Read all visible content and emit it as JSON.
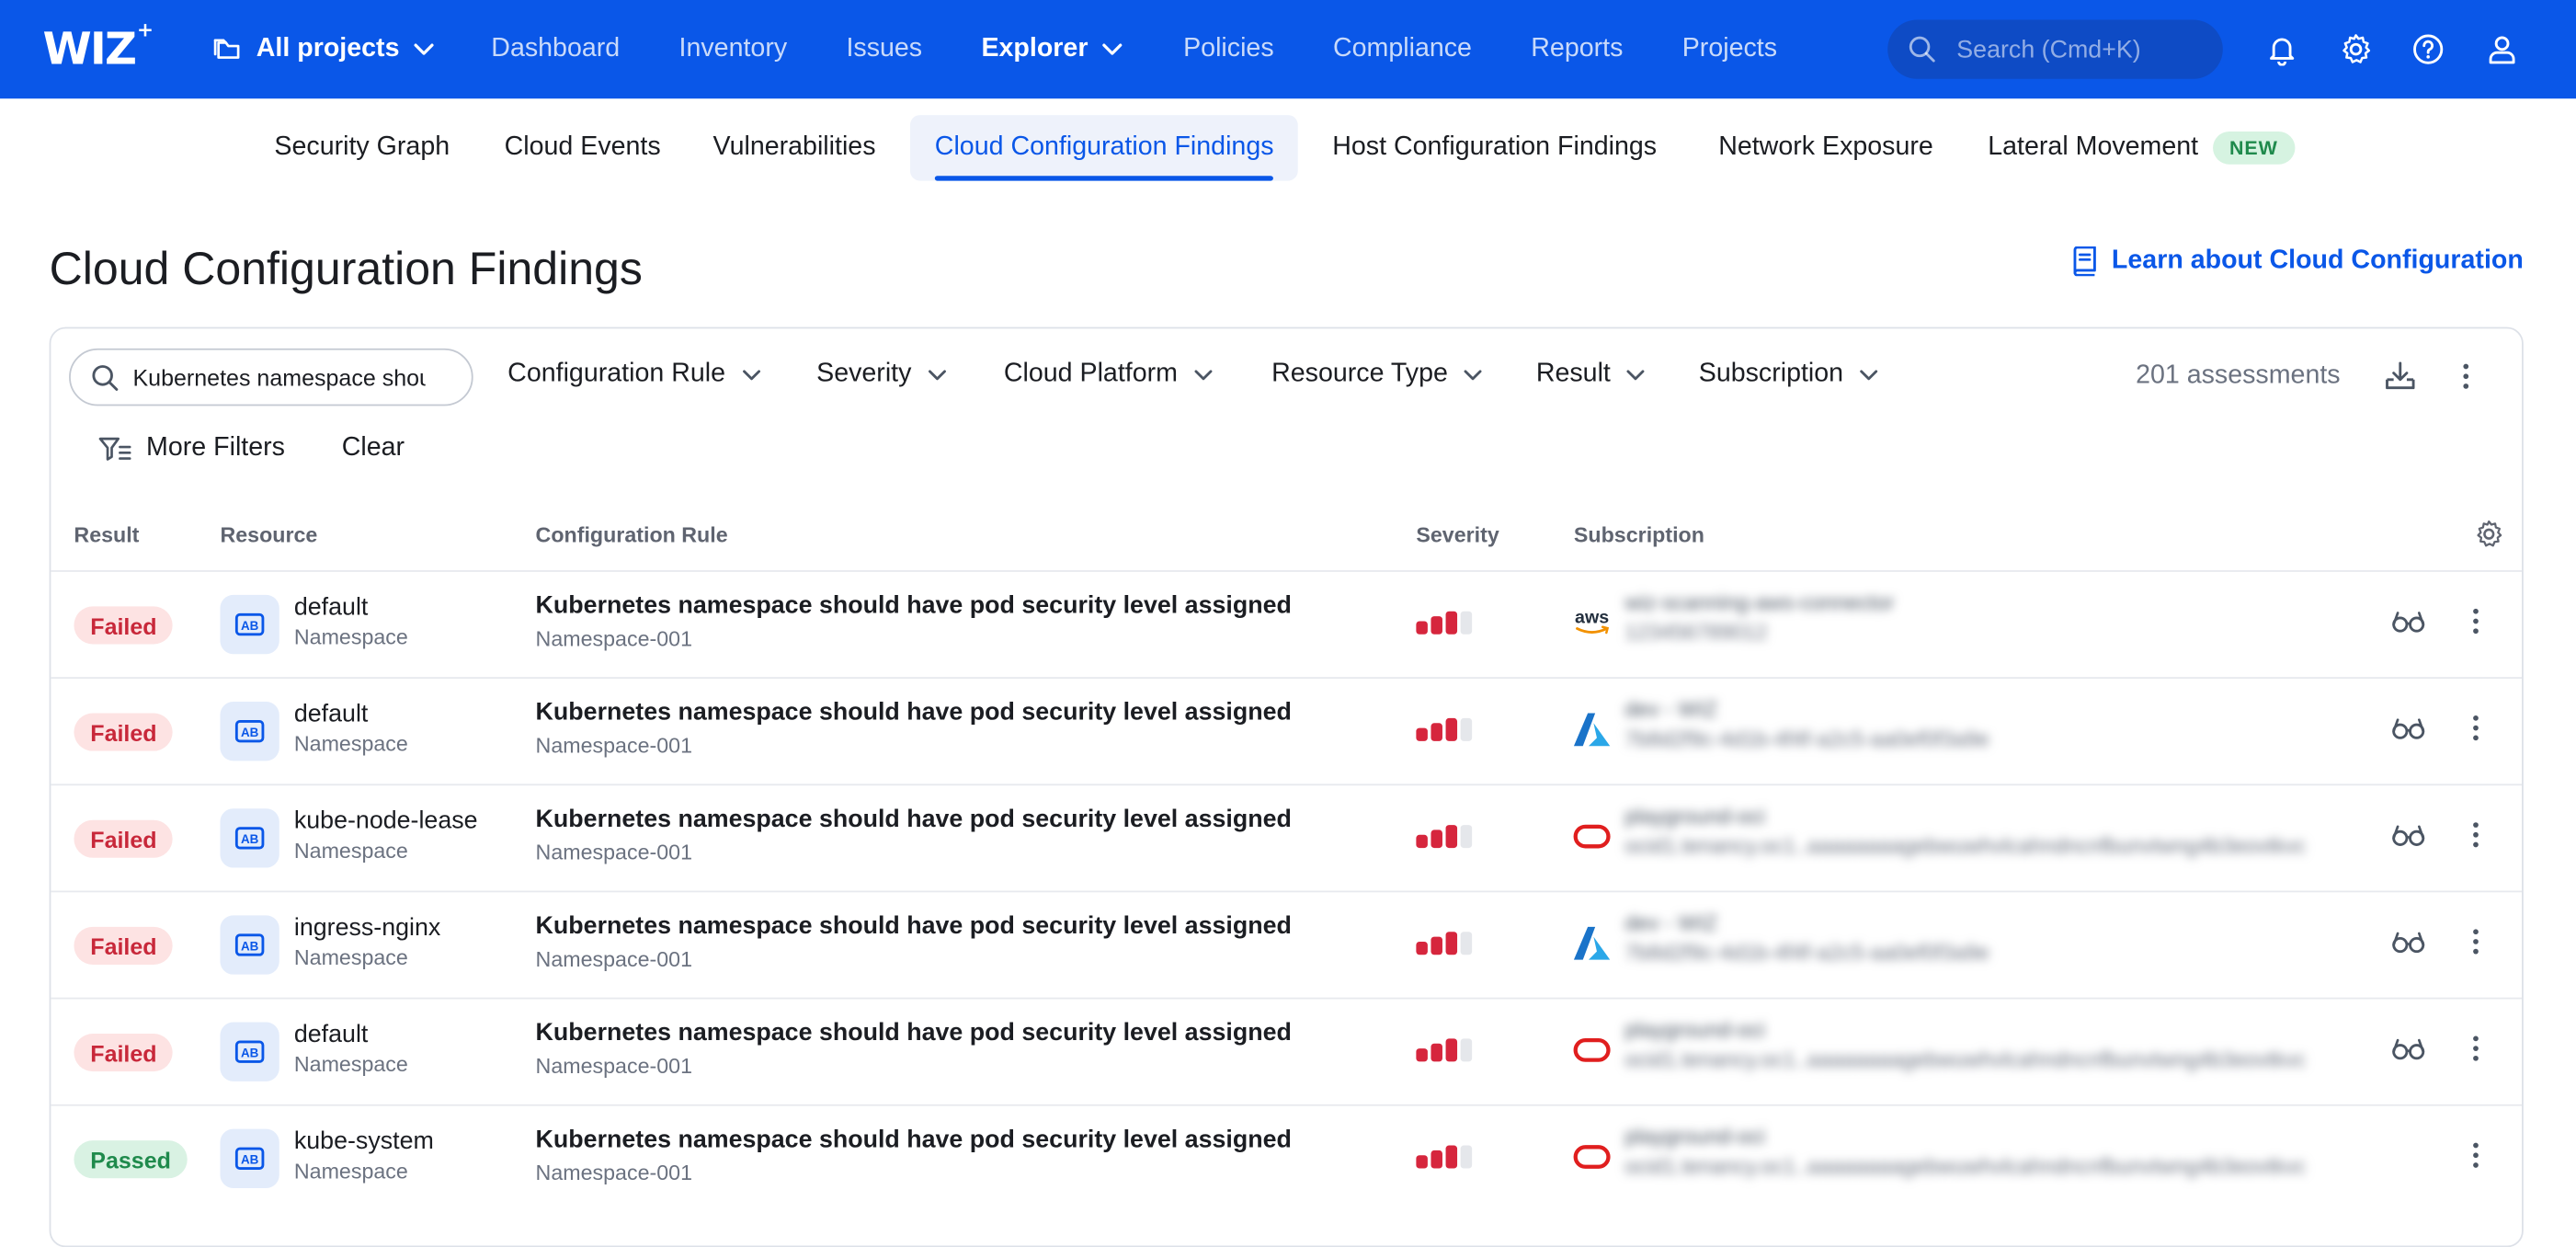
{
  "brand": {
    "name": "WIZ",
    "spark": "+"
  },
  "topnav": {
    "project_label": "All projects",
    "items": [
      {
        "label": "Dashboard"
      },
      {
        "label": "Inventory"
      },
      {
        "label": "Issues"
      },
      {
        "label": "Explorer",
        "active": true
      },
      {
        "label": "Policies"
      },
      {
        "label": "Compliance"
      },
      {
        "label": "Reports"
      },
      {
        "label": "Projects"
      }
    ],
    "search_placeholder": "Search (Cmd+K)"
  },
  "subnav": {
    "tabs": [
      {
        "label": "Security Graph"
      },
      {
        "label": "Cloud Events"
      },
      {
        "label": "Vulnerabilities"
      },
      {
        "label": "Cloud Configuration Findings",
        "active": true
      },
      {
        "label": "Host Configuration Findings"
      },
      {
        "label": "Network Exposure"
      },
      {
        "label": "Lateral Movement",
        "badge": "NEW"
      }
    ]
  },
  "page": {
    "title": "Cloud Configuration Findings",
    "learn_link": "Learn about Cloud Configuration"
  },
  "filters": {
    "search_value": "Kubernetes namespace shoul",
    "items": [
      {
        "label": "Configuration Rule"
      },
      {
        "label": "Severity"
      },
      {
        "label": "Cloud Platform"
      },
      {
        "label": "Resource Type"
      },
      {
        "label": "Result"
      },
      {
        "label": "Subscription"
      }
    ],
    "count": "201 assessments",
    "more_filters": "More Filters",
    "clear": "Clear"
  },
  "table": {
    "headers": {
      "result": "Result",
      "resource": "Resource",
      "rule": "Configuration Rule",
      "severity": "Severity",
      "subscription": "Subscription"
    },
    "rows": [
      {
        "result": "Failed",
        "resource": "default",
        "type": "Namespace",
        "rule": "Kubernetes namespace should have pod security level assigned",
        "rule_id": "Namespace-001",
        "severity_level": 3,
        "platform": "aws",
        "sub_name": "wiz-scanning-aws-connector",
        "sub_id": "123456789012",
        "has_graph": true
      },
      {
        "result": "Failed",
        "resource": "default",
        "type": "Namespace",
        "rule": "Kubernetes namespace should have pod security level assigned",
        "rule_id": "Namespace-001",
        "severity_level": 3,
        "platform": "azure",
        "sub_name": "dev - WIZ",
        "sub_id": "7b8d2f9c-4d1b-4f4f-a2c5-aa0ef0f3a9e",
        "has_graph": true
      },
      {
        "result": "Failed",
        "resource": "kube-node-lease",
        "type": "Namespace",
        "rule": "Kubernetes namespace should have pod security level assigned",
        "rule_id": "Namespace-001",
        "severity_level": 3,
        "platform": "oci",
        "sub_name": "playground-oci",
        "sub_id": "ocid1.tenancy.oc1..aaaaaaaagebwuwhvlcahndncnfbunvtwng4b3eovtkvcdee",
        "has_graph": true
      },
      {
        "result": "Failed",
        "resource": "ingress-nginx",
        "type": "Namespace",
        "rule": "Kubernetes namespace should have pod security level assigned",
        "rule_id": "Namespace-001",
        "severity_level": 3,
        "platform": "azure",
        "sub_name": "dev - WIZ",
        "sub_id": "7b8d2f9c-4d1b-4f4f-a2c5-aa0ef0f3a9e",
        "has_graph": true
      },
      {
        "result": "Failed",
        "resource": "default",
        "type": "Namespace",
        "rule": "Kubernetes namespace should have pod security level assigned",
        "rule_id": "Namespace-001",
        "severity_level": 3,
        "platform": "oci",
        "sub_name": "playground-oci",
        "sub_id": "ocid1.tenancy.oc1..aaaaaaaagebwuwhvlcahndncnfbunvtwng4b3eovtkvcdee",
        "has_graph": true
      },
      {
        "result": "Passed",
        "resource": "kube-system",
        "type": "Namespace",
        "rule": "Kubernetes namespace should have pod security level assigned",
        "rule_id": "Namespace-001",
        "severity_level": 3,
        "platform": "oci",
        "sub_name": "playground-oci",
        "sub_id": "ocid1.tenancy.oc1..aaaaaaaagebwuwhvlcahndncnfbunvtwng4b3eovtkvcdee",
        "has_graph": false
      }
    ]
  },
  "colors": {
    "brand_blue": "#0a57e8",
    "failed_text": "#c8283a",
    "failed_bg": "#fde3e3",
    "passed_text": "#1f8a4c",
    "passed_bg": "#d9f2e3",
    "severity_red": "#d6263d"
  }
}
